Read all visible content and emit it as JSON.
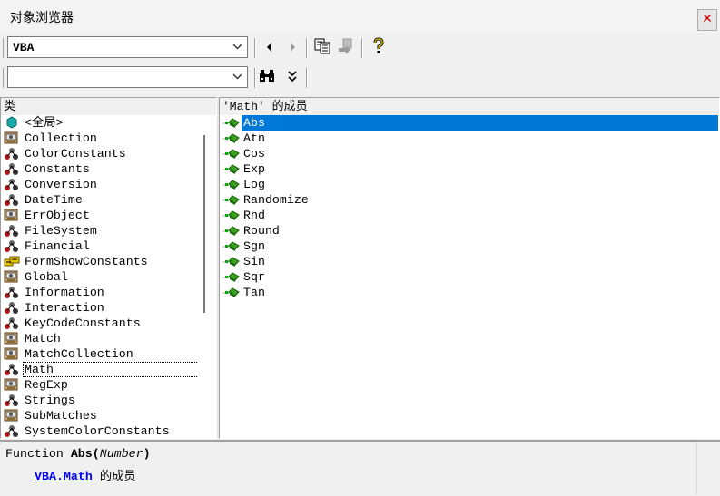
{
  "window": {
    "title": "对象浏览器",
    "close_glyph": "✕"
  },
  "toolbar": {
    "library_value": "VBA",
    "search_value": "",
    "icons": [
      "nav-back-icon",
      "nav-forward-icon",
      "copy-icon",
      "view-definition-icon",
      "help-icon",
      "binoculars-icon",
      "collapse-icon"
    ]
  },
  "classes": {
    "header": "类",
    "items": [
      {
        "label": "<全局>",
        "icon": "globe-icon"
      },
      {
        "label": "Collection",
        "icon": "class-icon"
      },
      {
        "label": "ColorConstants",
        "icon": "module-icon"
      },
      {
        "label": "Constants",
        "icon": "module-icon"
      },
      {
        "label": "Conversion",
        "icon": "module-icon"
      },
      {
        "label": "DateTime",
        "icon": "module-icon"
      },
      {
        "label": "ErrObject",
        "icon": "class-icon"
      },
      {
        "label": "FileSystem",
        "icon": "module-icon"
      },
      {
        "label": "Financial",
        "icon": "module-icon"
      },
      {
        "label": "FormShowConstants",
        "icon": "enum-icon"
      },
      {
        "label": "Global",
        "icon": "class-icon"
      },
      {
        "label": "Information",
        "icon": "module-icon"
      },
      {
        "label": "Interaction",
        "icon": "module-icon"
      },
      {
        "label": "KeyCodeConstants",
        "icon": "module-icon"
      },
      {
        "label": "Match",
        "icon": "class-icon"
      },
      {
        "label": "MatchCollection",
        "icon": "class-icon"
      },
      {
        "label": "Math",
        "icon": "module-icon"
      },
      {
        "label": "RegExp",
        "icon": "class-icon"
      },
      {
        "label": "Strings",
        "icon": "module-icon"
      },
      {
        "label": "SubMatches",
        "icon": "class-icon"
      },
      {
        "label": "SystemColorConstants",
        "icon": "module-icon"
      }
    ],
    "focused_index": 16
  },
  "members": {
    "header": "'Math' 的成员",
    "items": [
      "Abs",
      "Atn",
      "Cos",
      "Exp",
      "Log",
      "Randomize",
      "Rnd",
      "Round",
      "Sgn",
      "Sin",
      "Sqr",
      "Tan"
    ],
    "selected_index": 0
  },
  "details": {
    "kind": "Function ",
    "name": "Abs",
    "open_paren": "(",
    "param": "Number",
    "close_paren": ")",
    "lib_link": "VBA",
    "dot": ".",
    "class_link": "Math",
    "member_of": " 的成员"
  },
  "colors": {
    "selection": "#0078d7",
    "link": "#0000ff",
    "close": "#cc0000"
  }
}
